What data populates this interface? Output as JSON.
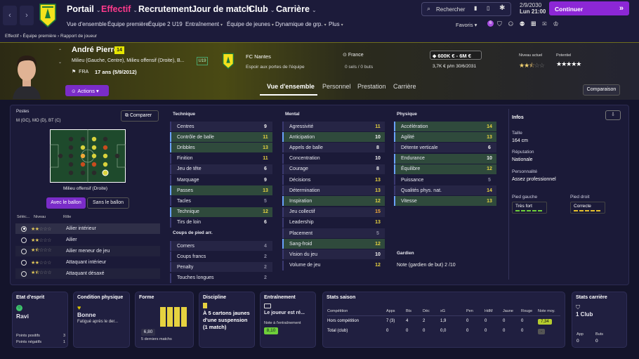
{
  "nav": {
    "menus": [
      "Portail",
      "Effectif",
      "Recrutement",
      "Jour de match",
      "Club",
      "Carrière"
    ],
    "submenus": [
      "Vue d'ensemble",
      "Équipe première",
      "Équipe 2",
      "U19",
      "Entraînement",
      "Équipe de jeunes",
      "Dynamique de grp.",
      "Plus"
    ],
    "search_label": "Rechercher",
    "date": "2/9/2030",
    "time": "Lun  21:00",
    "continue_label": "Continuer",
    "favoris_label": "Favoris",
    "favoris_badge": "6"
  },
  "breadcrumb": [
    "Effectif",
    "Équipe première",
    "Rapport de joueur"
  ],
  "player": {
    "name": "André Pierron",
    "number": "14",
    "positions_long": "Milieu (Gauche, Centre), Milieu offensif (Droite), B...",
    "nationality": "FRA",
    "age": "17 ans (5/9/2012)",
    "squad": "U19",
    "club": "FC Nantes",
    "club_status": "Espoir aux portes de l'équipe",
    "country": "France",
    "caps": "0 sels / 0 buts",
    "value": "600K € - 6M €",
    "wage": "3,7K € p/m 30/6/2031",
    "actions_label": "Actions",
    "level_label": "Niveau actuel",
    "potential_label": "Potentiel",
    "level_stars": 2.5,
    "potential_stars": 5
  },
  "tabs": [
    "Vue d'ensemble",
    "Personnel",
    "Prestation",
    "Carrière"
  ],
  "compare_label": "Comparaison",
  "positions": {
    "title": "Postes",
    "list": "M (GC), MO (D), BT (C)",
    "compare_btn": "Comparer",
    "selected_role": "Milieu offensif (Droite)",
    "with_ball": "Avec le ballon",
    "without_ball": "Sans le ballon",
    "col_select": "Séléc...",
    "col_level": "Niveau",
    "col_role": "Rôle",
    "roles": [
      {
        "name": "Ailier intérieur",
        "stars": 2.5,
        "selected": true
      },
      {
        "name": "Ailier",
        "stars": 2.5,
        "selected": false
      },
      {
        "name": "Ailier meneur de jeu",
        "stars": 1.5,
        "selected": false
      },
      {
        "name": "Attaquant intérieur",
        "stars": 2.5,
        "selected": false
      },
      {
        "name": "Attaquant désaxé",
        "stars": 1.5,
        "selected": false
      }
    ]
  },
  "attributes": {
    "technique_title": "Technique",
    "technique": [
      {
        "name": "Centres",
        "value": "9"
      },
      {
        "name": "Contrôle de balle",
        "value": "11"
      },
      {
        "name": "Dribbles",
        "value": "13"
      },
      {
        "name": "Finition",
        "value": "11"
      },
      {
        "name": "Jeu de tête",
        "value": "6"
      },
      {
        "name": "Marquage",
        "value": "9"
      },
      {
        "name": "Passes",
        "value": "13"
      },
      {
        "name": "Tacles",
        "value": "5"
      },
      {
        "name": "Technique",
        "value": "12"
      },
      {
        "name": "Tirs de loin",
        "value": "6"
      }
    ],
    "setpieces_title": "Coups de pied arr.",
    "setpieces": [
      {
        "name": "Corners",
        "value": "4"
      },
      {
        "name": "Coups francs",
        "value": "2"
      },
      {
        "name": "Penalty",
        "value": "2"
      },
      {
        "name": "Touches longues",
        "value": "2"
      }
    ],
    "mental_title": "Mental",
    "mental": [
      {
        "name": "Agressivité",
        "value": "11"
      },
      {
        "name": "Anticipation",
        "value": "10"
      },
      {
        "name": "Appels de balle",
        "value": "8"
      },
      {
        "name": "Concentration",
        "value": "10"
      },
      {
        "name": "Courage",
        "value": "8"
      },
      {
        "name": "Décisions",
        "value": "13"
      },
      {
        "name": "Détermination",
        "value": "13"
      },
      {
        "name": "Inspiration",
        "value": "12"
      },
      {
        "name": "Jeu collectif",
        "value": "15"
      },
      {
        "name": "Leadership",
        "value": "13"
      },
      {
        "name": "Placement",
        "value": "5"
      },
      {
        "name": "Sang-froid",
        "value": "12"
      },
      {
        "name": "Vision du jeu",
        "value": "10"
      },
      {
        "name": "Volume de jeu",
        "value": "12"
      }
    ],
    "physical_title": "Physique",
    "physical": [
      {
        "name": "Accélération",
        "value": "14"
      },
      {
        "name": "Agilité",
        "value": "13"
      },
      {
        "name": "Détente verticale",
        "value": "6"
      },
      {
        "name": "Endurance",
        "value": "10"
      },
      {
        "name": "Équilibre",
        "value": "12"
      },
      {
        "name": "Puissance",
        "value": "5"
      },
      {
        "name": "Qualités phys. nat.",
        "value": "14"
      },
      {
        "name": "Vitesse",
        "value": "13"
      }
    ],
    "goalkeeper_title": "Gardien",
    "goalkeeper_label": "Note (gardien de but)",
    "goalkeeper_value": "2 /10"
  },
  "info": {
    "title": "Infos",
    "height_label": "Taille",
    "height": "164 cm",
    "reputation_label": "Réputation",
    "reputation": "Nationale",
    "personality_label": "Personnalité",
    "personality": "Assez professionnel",
    "left_foot_label": "Pied gauche",
    "left_foot": "Très fort",
    "right_foot_label": "Pied droit",
    "right_foot": "Correcte"
  },
  "cards": {
    "morale_title": "Etat d'esprit",
    "morale": "Ravi",
    "pos_points_label": "Points positifs",
    "pos_points": "3",
    "neg_points_label": "Points négatifs",
    "neg_points": "1",
    "condition_title": "Condition physique",
    "condition": "Bonne",
    "condition_note": "Fatigué après le der...",
    "form_title": "Forme",
    "form_avg": "6,80",
    "form_label": "5 derniers matchs",
    "discipline_title": "Discipline",
    "discipline_text": "À 5 cartons jaunes d'une suspension (1 match)",
    "training_title": "Entraînement",
    "training_text": "Le joueur est ré...",
    "training_note_label": "Note à l'entraînement",
    "training_note": "8,10",
    "season_title": "Stats saison",
    "season_headers": [
      "Compétition",
      "Apps",
      "Bts",
      "Déc",
      "xG",
      "Pen",
      "HdM",
      "Jaune",
      "Rouge",
      "Note moy."
    ],
    "season_rows": [
      [
        "Hors compétition",
        "7 (3)",
        "4",
        "2",
        "1,9",
        "0",
        "0",
        "0",
        "0",
        "7,34"
      ],
      [
        "Total (club)",
        "0",
        "0",
        "0",
        "0,0",
        "0",
        "0",
        "0",
        "0",
        "-"
      ]
    ],
    "career_title": "Stats carrière",
    "career_club": "1 Club",
    "career_apps_label": "App",
    "career_apps": "0",
    "career_goals_label": "Buts",
    "career_goals": "0"
  },
  "colors": {
    "accent": "#ff3a8c",
    "purple": "#8c27d6",
    "yellow": "#e6e600",
    "orange": "#f2a93b"
  }
}
